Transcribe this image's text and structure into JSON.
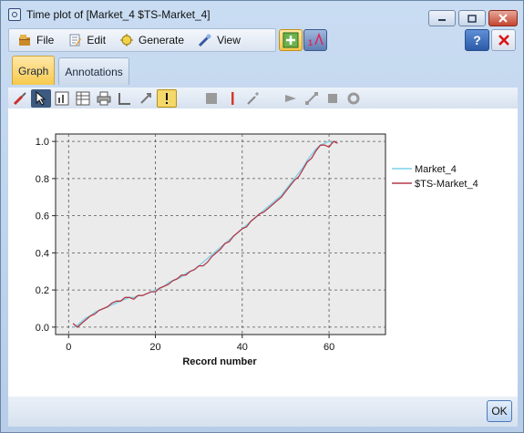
{
  "window": {
    "title": "Time plot of [Market_4 $TS-Market_4]"
  },
  "menu": {
    "items": [
      {
        "key": "file",
        "label": "File",
        "icon": "file-icon"
      },
      {
        "key": "edit",
        "label": "Edit",
        "icon": "edit-icon"
      },
      {
        "key": "generate",
        "label": "Generate",
        "icon": "generate-icon"
      },
      {
        "key": "view",
        "label": "View",
        "icon": "view-icon"
      }
    ]
  },
  "tabs": [
    {
      "label": "Graph",
      "active": true
    },
    {
      "label": "Annotations",
      "active": false
    }
  ],
  "footer": {
    "ok_label": "OK"
  },
  "colors": {
    "series1": "#7fd0e8",
    "series2": "#b03a48",
    "plot_bg": "#ebebeb",
    "tab_active": "#f6c94d"
  },
  "chart_data": {
    "type": "line",
    "title": "",
    "xlabel": "Record number",
    "ylabel": "",
    "xlim": [
      -3,
      73
    ],
    "ylim": [
      -0.04,
      1.04
    ],
    "xticks": [
      0,
      20,
      40,
      60
    ],
    "yticks": [
      0.0,
      0.2,
      0.4,
      0.6,
      0.8,
      1.0
    ],
    "xtick_labels": [
      "0",
      "20",
      "40",
      "60"
    ],
    "ytick_labels": [
      "0.0",
      "0.2",
      "0.4",
      "0.6",
      "0.8",
      "1.0"
    ],
    "grid": true,
    "legend": "right",
    "series": [
      {
        "name": "Market_4",
        "color": "#7fd0e8",
        "x": [
          1,
          2,
          3,
          4,
          5,
          6,
          7,
          8,
          9,
          10,
          11,
          12,
          13,
          14,
          15,
          16,
          17,
          18,
          19,
          20,
          21,
          22,
          23,
          24,
          25,
          26,
          27,
          28,
          29,
          30,
          31,
          32,
          33,
          34,
          35,
          36,
          37,
          38,
          39,
          40,
          41,
          42,
          43,
          44,
          45,
          46,
          47,
          48,
          49,
          50,
          51,
          52,
          53,
          54,
          55,
          56,
          57,
          58,
          59,
          60,
          61
        ],
        "y": [
          0.0,
          0.01,
          0.03,
          0.05,
          0.06,
          0.08,
          0.09,
          0.1,
          0.11,
          0.12,
          0.13,
          0.14,
          0.15,
          0.16,
          0.16,
          0.17,
          0.17,
          0.18,
          0.19,
          0.2,
          0.21,
          0.22,
          0.24,
          0.25,
          0.26,
          0.27,
          0.29,
          0.3,
          0.31,
          0.33,
          0.35,
          0.37,
          0.39,
          0.41,
          0.43,
          0.45,
          0.47,
          0.49,
          0.51,
          0.53,
          0.55,
          0.57,
          0.59,
          0.61,
          0.63,
          0.65,
          0.67,
          0.69,
          0.71,
          0.74,
          0.77,
          0.8,
          0.83,
          0.86,
          0.9,
          0.93,
          0.96,
          0.98,
          0.99,
          1.0,
          0.99
        ]
      },
      {
        "name": "$TS-Market_4",
        "color": "#b03a48",
        "x": [
          1,
          2,
          3,
          4,
          5,
          6,
          7,
          8,
          9,
          10,
          11,
          12,
          13,
          14,
          15,
          16,
          17,
          18,
          19,
          20,
          21,
          22,
          23,
          24,
          25,
          26,
          27,
          28,
          29,
          30,
          31,
          32,
          33,
          34,
          35,
          36,
          37,
          38,
          39,
          40,
          41,
          42,
          43,
          44,
          45,
          46,
          47,
          48,
          49,
          50,
          51,
          52,
          53,
          54,
          55,
          56,
          57,
          58,
          59,
          60,
          61,
          62
        ],
        "y": [
          0.02,
          0.0,
          0.02,
          0.04,
          0.06,
          0.07,
          0.09,
          0.1,
          0.11,
          0.13,
          0.14,
          0.14,
          0.16,
          0.16,
          0.15,
          0.17,
          0.17,
          0.18,
          0.19,
          0.19,
          0.21,
          0.22,
          0.23,
          0.25,
          0.26,
          0.28,
          0.28,
          0.3,
          0.31,
          0.33,
          0.33,
          0.35,
          0.38,
          0.4,
          0.42,
          0.45,
          0.46,
          0.49,
          0.51,
          0.53,
          0.54,
          0.57,
          0.59,
          0.61,
          0.62,
          0.64,
          0.66,
          0.68,
          0.7,
          0.73,
          0.76,
          0.79,
          0.81,
          0.85,
          0.89,
          0.91,
          0.95,
          0.98,
          0.98,
          0.97,
          1.0,
          0.99
        ]
      }
    ]
  }
}
